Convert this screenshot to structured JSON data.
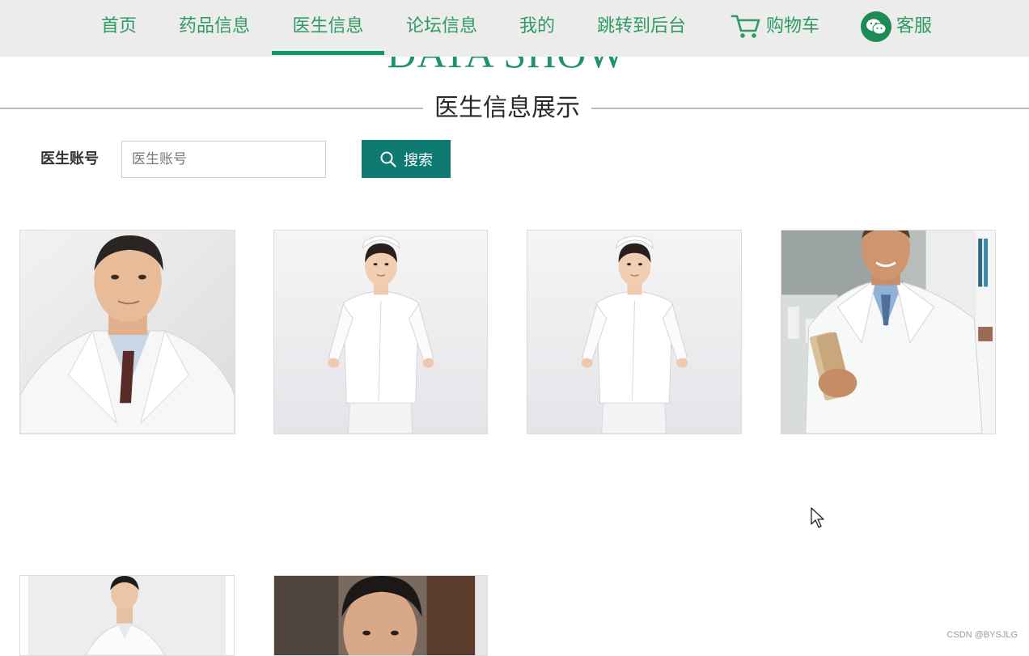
{
  "nav": {
    "items": [
      {
        "label": "首页"
      },
      {
        "label": "药品信息"
      },
      {
        "label": "医生信息"
      },
      {
        "label": "论坛信息"
      },
      {
        "label": "我的"
      },
      {
        "label": "跳转到后台"
      },
      {
        "label": "购物车",
        "icon": "cart-icon"
      },
      {
        "label": "客服",
        "icon": "wechat-icon"
      }
    ],
    "active": "医生信息"
  },
  "header": {
    "eyebrow": "DATA SHOW",
    "title": "医生信息展示"
  },
  "search": {
    "label": "医生账号",
    "placeholder": "医生账号",
    "value": "",
    "button_label": "搜索",
    "button_icon": "search-icon"
  },
  "doctors": [
    {
      "photo": "male-doctor-portrait"
    },
    {
      "photo": "nurse-uniform"
    },
    {
      "photo": "nurse-uniform"
    },
    {
      "photo": "doctor-with-books"
    },
    {
      "photo": "doctor-white-coat"
    },
    {
      "photo": "doctor-portrait"
    }
  ],
  "watermark": "CSDN @BYSJLG",
  "colors": {
    "nav_bg": "#ececec",
    "nav_text": "#2f9a63",
    "active_underline": "#11956a",
    "accent": "#1c9466",
    "button": "#0f7a72"
  }
}
